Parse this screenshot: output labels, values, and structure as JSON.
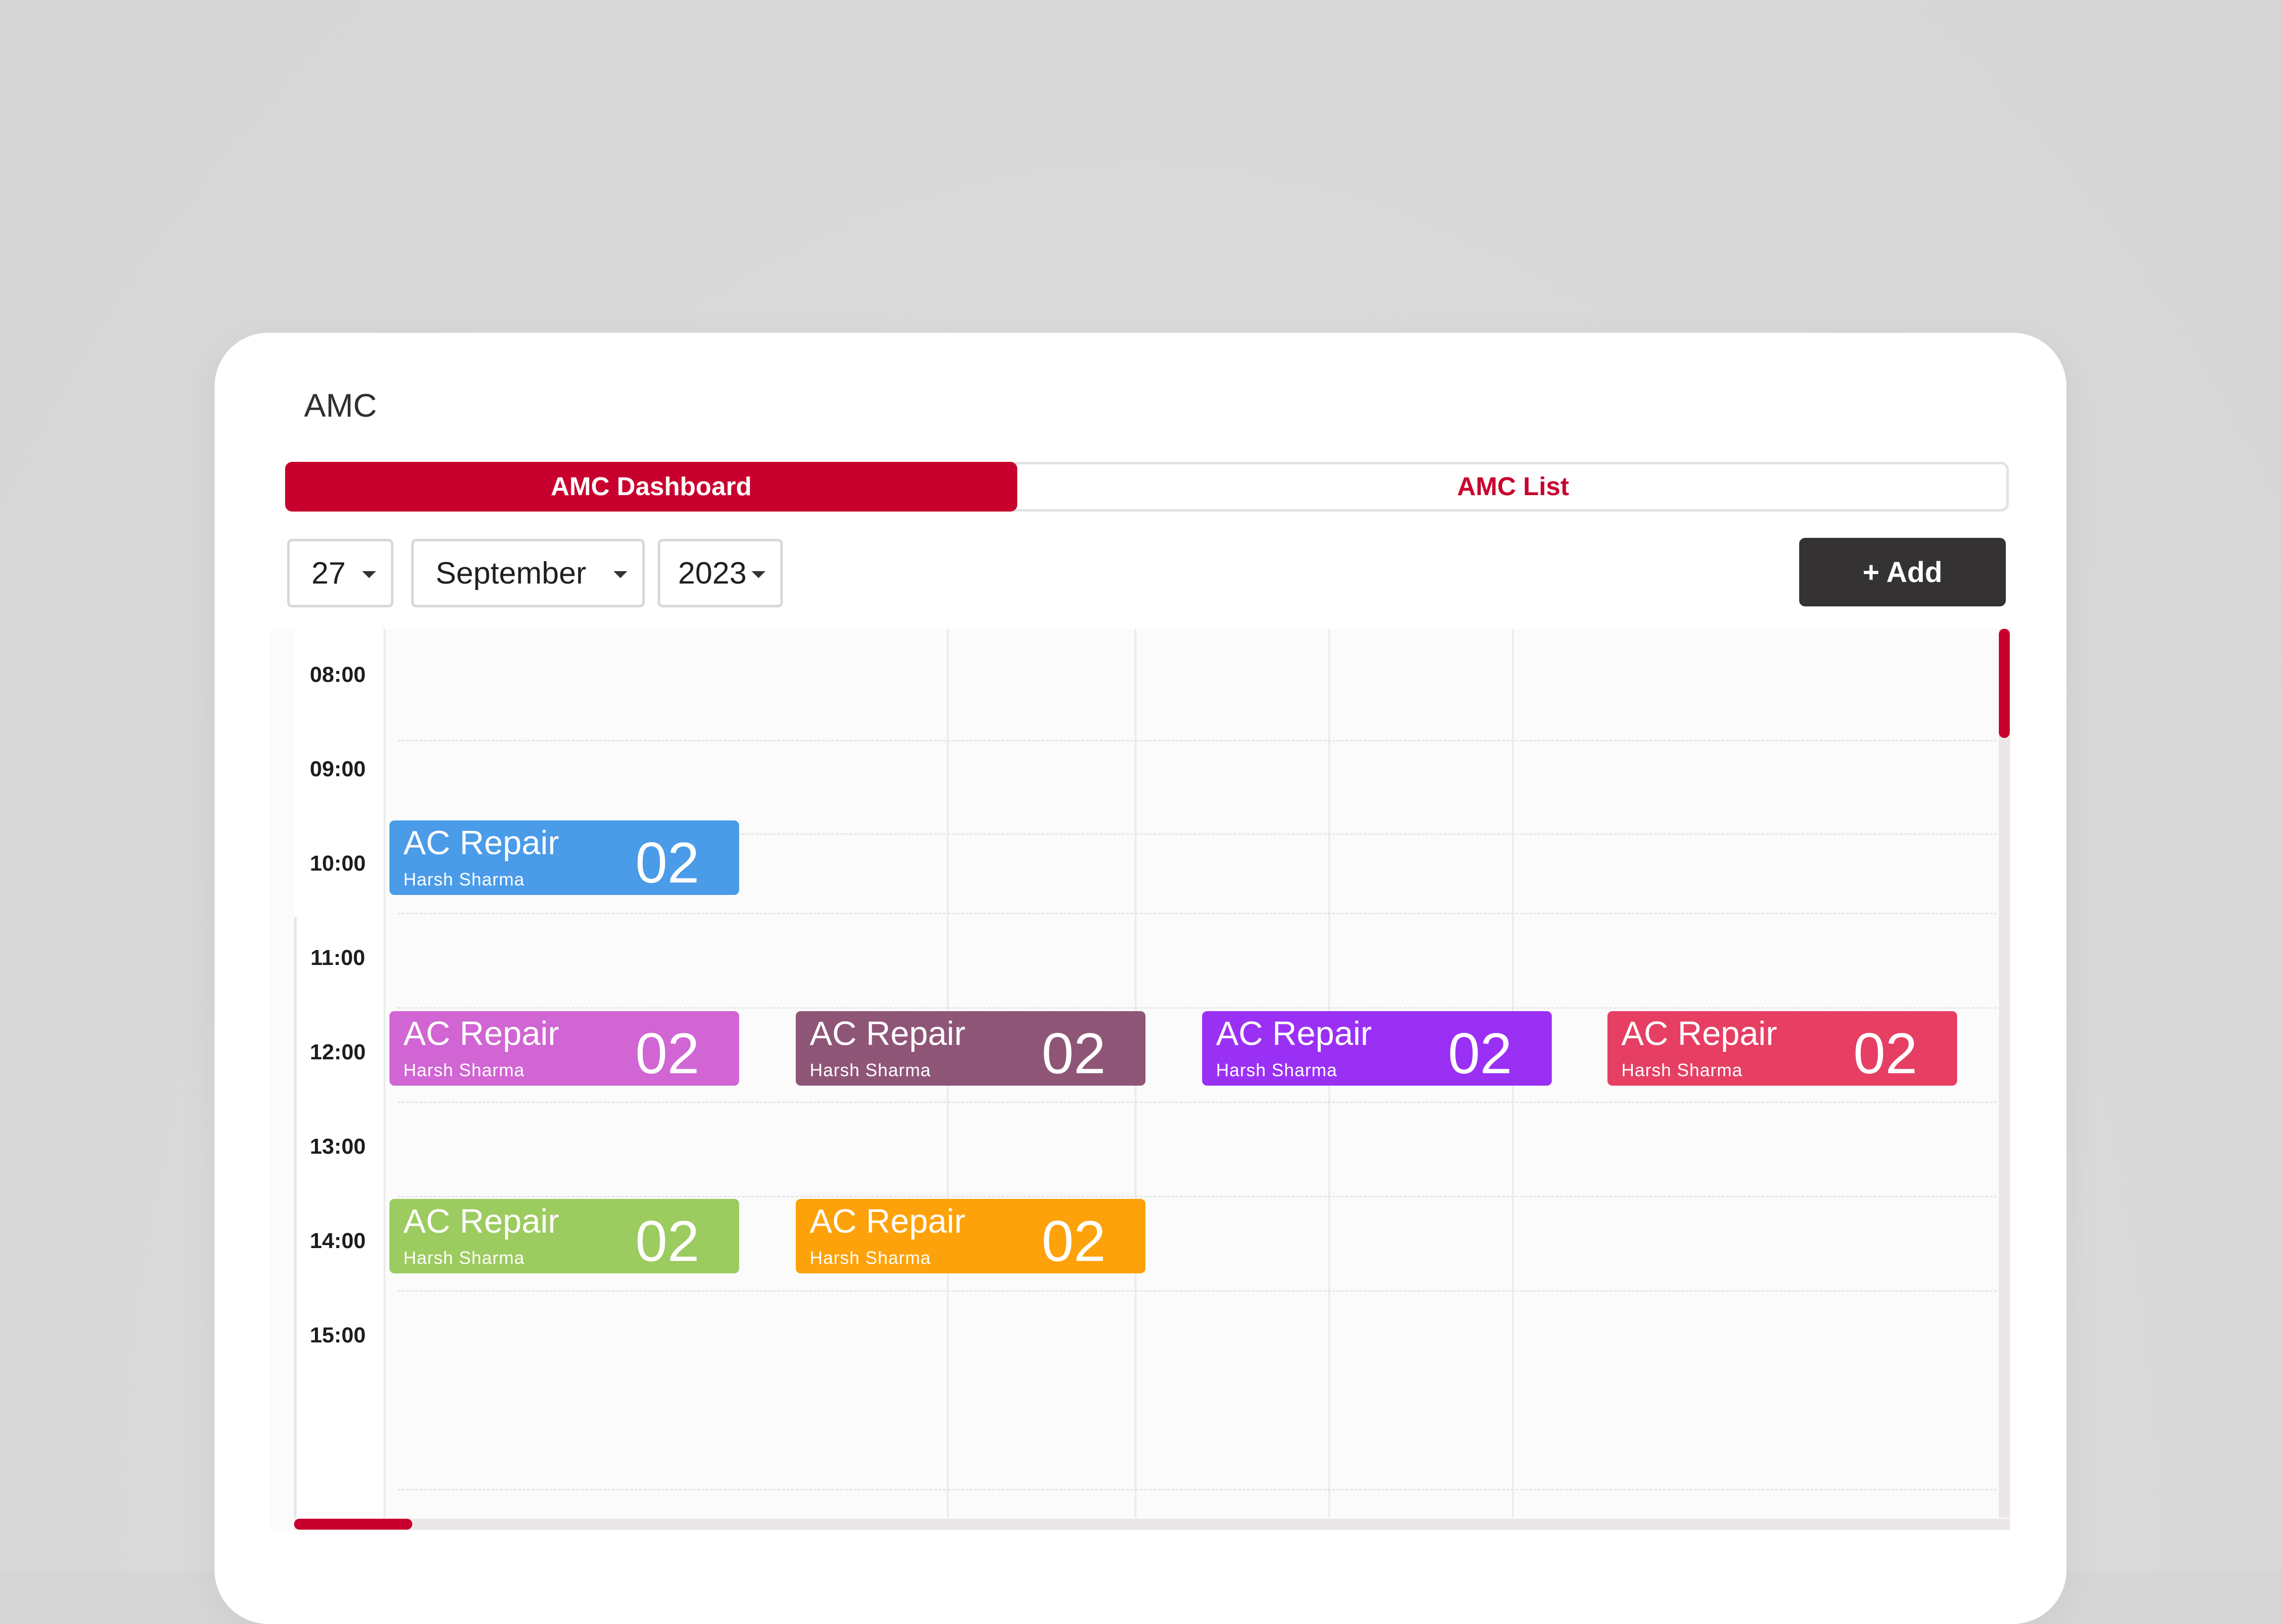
{
  "app": {
    "title": "AMC"
  },
  "tabs": [
    {
      "label": "AMC Dashboard",
      "active": true
    },
    {
      "label": "AMC List",
      "active": false
    }
  ],
  "filters": {
    "day": "27",
    "month": "September",
    "year": "2023"
  },
  "toolbar": {
    "add_label": "+ Add"
  },
  "calendar": {
    "time_slots": [
      "08:00",
      "09:00",
      "10:00",
      "11:00",
      "12:00",
      "13:00",
      "14:00",
      "15:00"
    ],
    "events": [
      {
        "title": "AC Repair",
        "assignee": "Harsh Sharma",
        "count": "02",
        "color": "#4a9be8",
        "time": "10:00",
        "column": 1
      },
      {
        "title": "AC Repair",
        "assignee": "Harsh Sharma",
        "count": "02",
        "color": "#d065d3",
        "time": "12:00",
        "column": 1
      },
      {
        "title": "AC Repair",
        "assignee": "Harsh Sharma",
        "count": "02",
        "color": "#8e5577",
        "time": "12:00",
        "column": 2
      },
      {
        "title": "AC Repair",
        "assignee": "Harsh Sharma",
        "count": "02",
        "color": "#9b30f5",
        "time": "12:00",
        "column": 3
      },
      {
        "title": "AC Repair",
        "assignee": "Harsh Sharma",
        "count": "02",
        "color": "#e63f63",
        "time": "12:00",
        "column": 4
      },
      {
        "title": "AC Repair",
        "assignee": "Harsh Sharma",
        "count": "02",
        "color": "#9ccb5f",
        "time": "14:00",
        "column": 1
      },
      {
        "title": "AC Repair",
        "assignee": "Harsh Sharma",
        "count": "02",
        "color": "#fda20a",
        "time": "14:00",
        "column": 2
      }
    ]
  },
  "theme": {
    "accent": "#c8002d",
    "add_button_bg": "#353233"
  }
}
